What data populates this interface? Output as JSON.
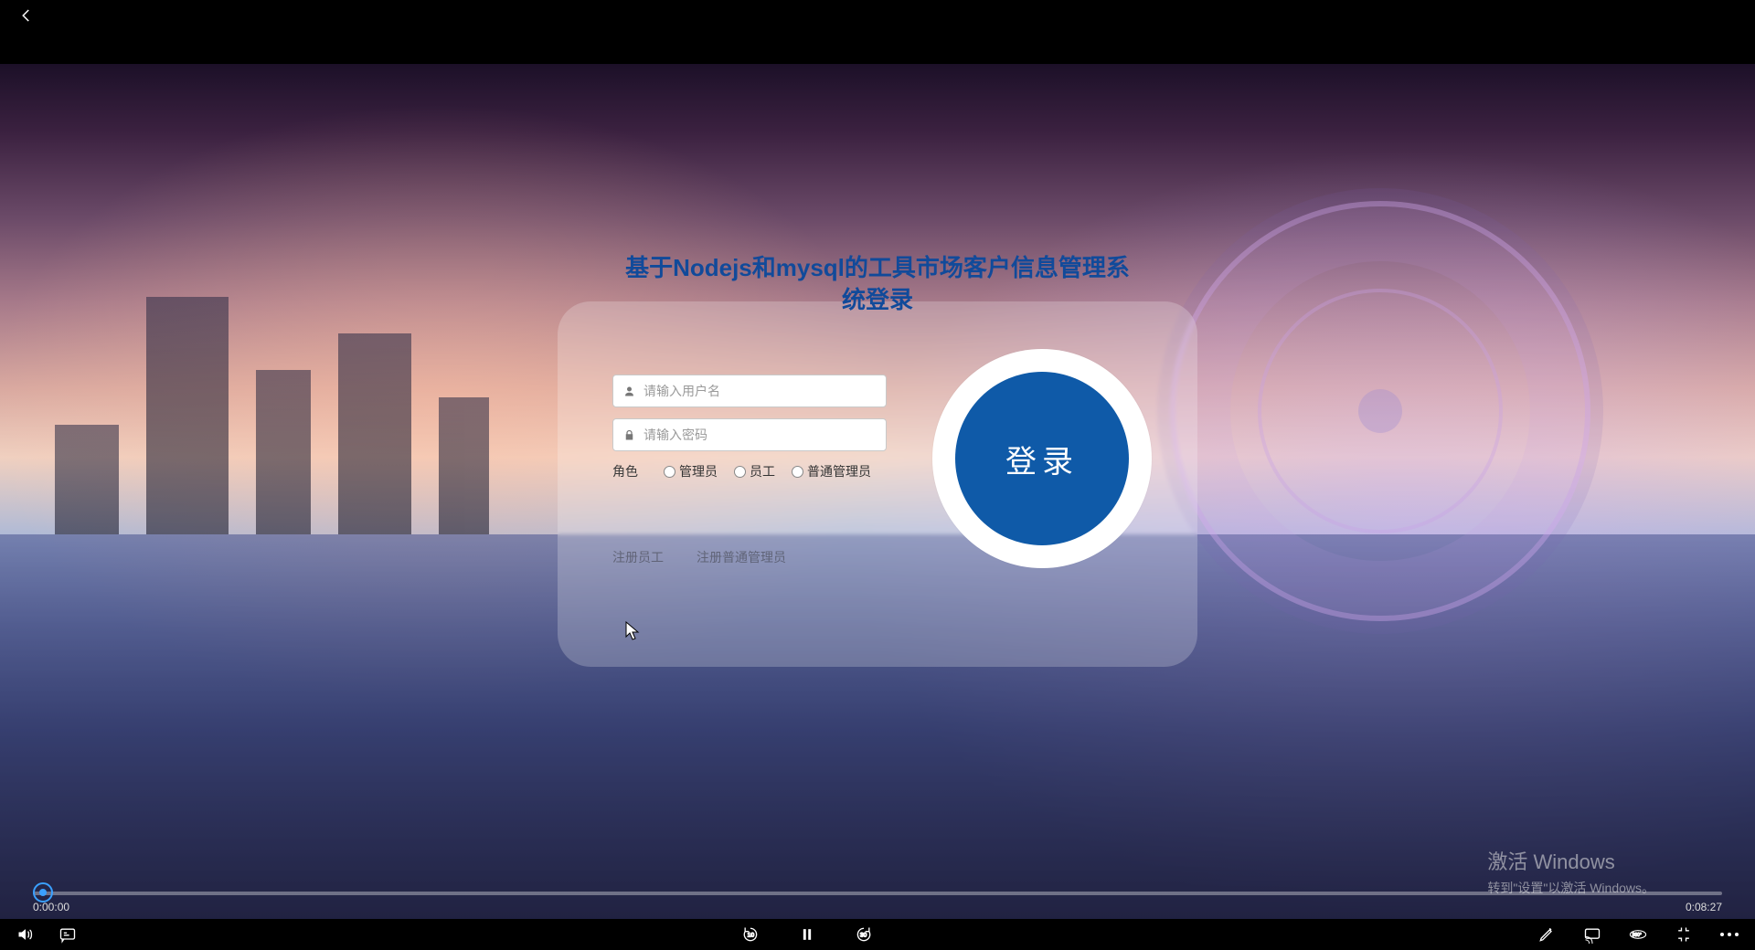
{
  "topbar": {},
  "login": {
    "title": "基于Nodejs和mysql的工具市场客户信息管理系统登录",
    "username_placeholder": "请输入用户名",
    "password_placeholder": "请输入密码",
    "role_label": "角色",
    "roles": {
      "admin": "管理员",
      "staff": "员工",
      "normal_admin": "普通管理员"
    },
    "links": {
      "register_staff": "注册员工",
      "register_normal_admin": "注册普通管理员"
    },
    "login_button": "登录"
  },
  "watermark": {
    "line1": "激活 Windows",
    "line2": "转到\"设置\"以激活 Windows。"
  },
  "player": {
    "current_time": "0:00:00",
    "total_time": "0:08:27",
    "skip_back_seconds": "10",
    "skip_fwd_seconds": "30",
    "vr_label": "360°"
  }
}
